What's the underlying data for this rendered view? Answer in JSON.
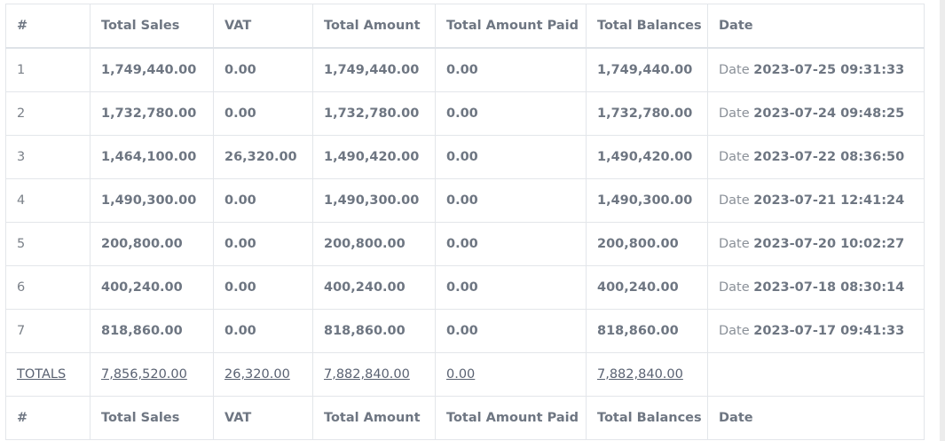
{
  "table": {
    "headers": [
      "#",
      "Total Sales",
      "VAT",
      "Total Amount",
      "Total Amount Paid",
      "Total Balances",
      "Date"
    ],
    "date_prefix": "Date",
    "rows": [
      {
        "n": "1",
        "sales": "1,749,440.00",
        "vat": "0.00",
        "amount": "1,749,440.00",
        "paid": "0.00",
        "balance": "1,749,440.00",
        "date": "2023-07-25 09:31:33"
      },
      {
        "n": "2",
        "sales": "1,732,780.00",
        "vat": "0.00",
        "amount": "1,732,780.00",
        "paid": "0.00",
        "balance": "1,732,780.00",
        "date": "2023-07-24 09:48:25"
      },
      {
        "n": "3",
        "sales": "1,464,100.00",
        "vat": "26,320.00",
        "amount": "1,490,420.00",
        "paid": "0.00",
        "balance": "1,490,420.00",
        "date": "2023-07-22 08:36:50"
      },
      {
        "n": "4",
        "sales": "1,490,300.00",
        "vat": "0.00",
        "amount": "1,490,300.00",
        "paid": "0.00",
        "balance": "1,490,300.00",
        "date": "2023-07-21 12:41:24"
      },
      {
        "n": "5",
        "sales": "200,800.00",
        "vat": "0.00",
        "amount": "200,800.00",
        "paid": "0.00",
        "balance": "200,800.00",
        "date": "2023-07-20 10:02:27"
      },
      {
        "n": "6",
        "sales": "400,240.00",
        "vat": "0.00",
        "amount": "400,240.00",
        "paid": "0.00",
        "balance": "400,240.00",
        "date": "2023-07-18 08:30:14"
      },
      {
        "n": "7",
        "sales": "818,860.00",
        "vat": "0.00",
        "amount": "818,860.00",
        "paid": "0.00",
        "balance": "818,860.00",
        "date": "2023-07-17 09:41:33"
      }
    ],
    "totals": {
      "label": "TOTALS",
      "sales": "7,856,520.00",
      "vat": "26,320.00",
      "amount": "7,882,840.00",
      "paid": "0.00",
      "balance": "7,882,840.00"
    }
  }
}
